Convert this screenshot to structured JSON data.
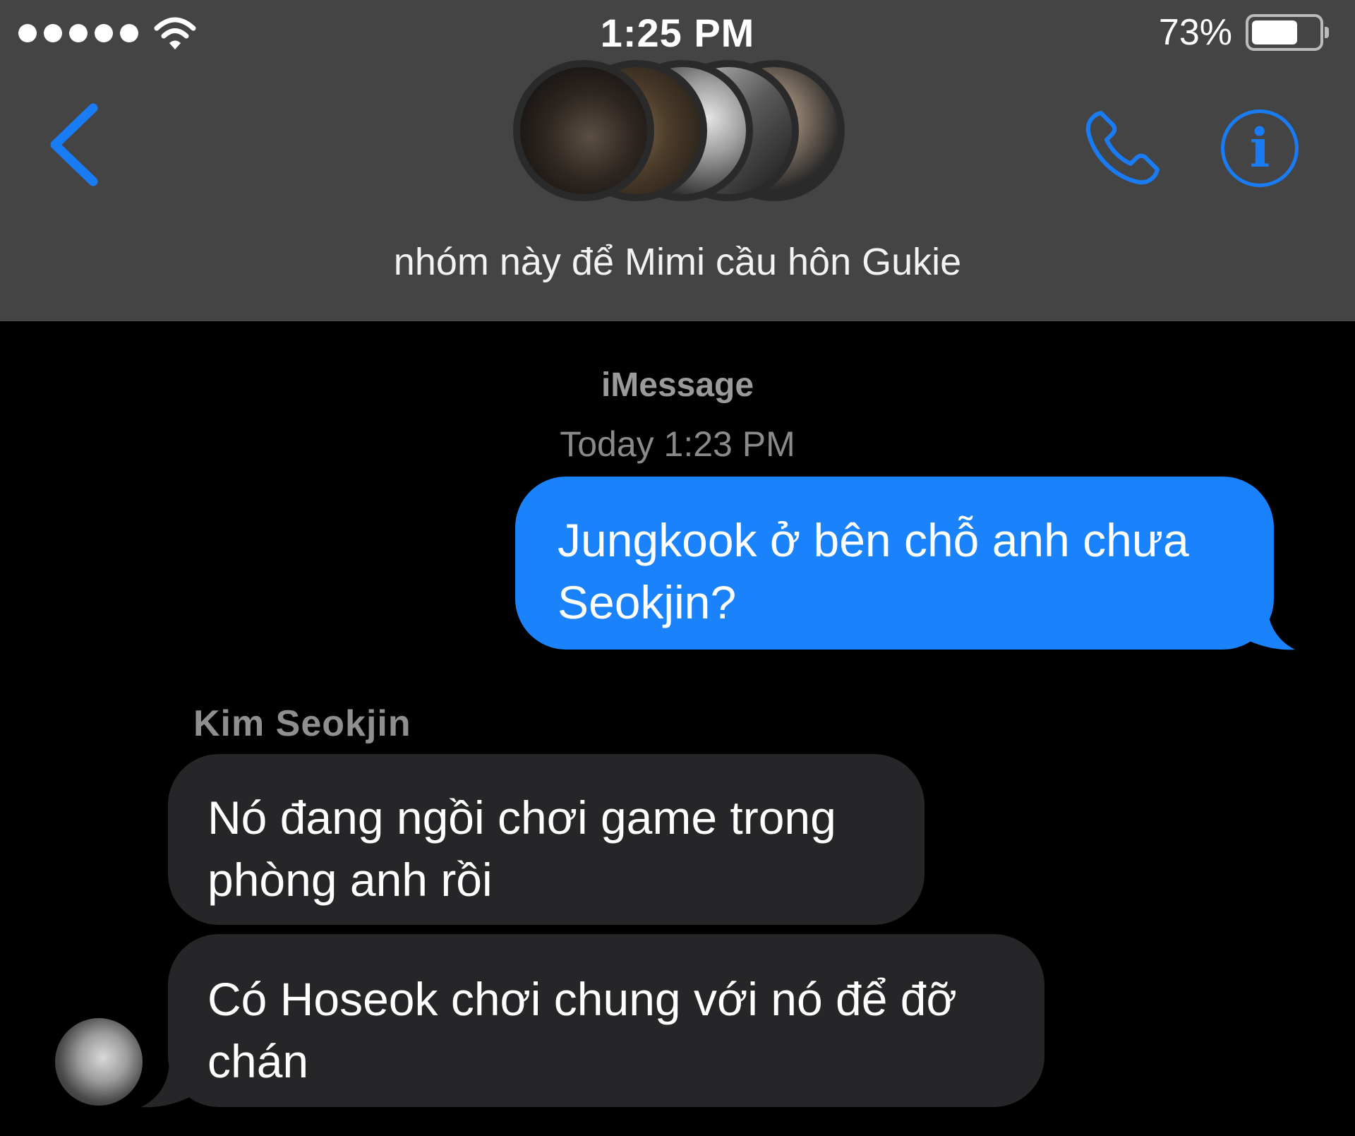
{
  "status_bar": {
    "time": "1:25 PM",
    "battery_percent": "73%",
    "battery_level": 0.73,
    "signal_bars": 5
  },
  "header": {
    "group_name": "nhóm này để Mimi cầu hôn Gukie",
    "info_glyph": "i",
    "accent_color": "#1a7cf5",
    "icons": [
      "back-chevron-icon",
      "phone-icon",
      "info-icon"
    ]
  },
  "conversation": {
    "service": "iMessage",
    "timestamp": "Today 1:23 PM",
    "messages": [
      {
        "direction": "outgoing",
        "lines": [
          "Jungkook ở bên chỗ anh chưa",
          "Seokjin?"
        ],
        "color": "#1a82fb"
      },
      {
        "direction": "incoming",
        "sender": "Kim Seokjin",
        "lines": [
          "Nó đang ngồi chơi game trong",
          "phòng anh rồi"
        ],
        "color": "#262629"
      },
      {
        "direction": "incoming",
        "lines": [
          "Có Hoseok chơi chung với nó để đỡ",
          "chán"
        ],
        "color": "#262629"
      }
    ]
  }
}
